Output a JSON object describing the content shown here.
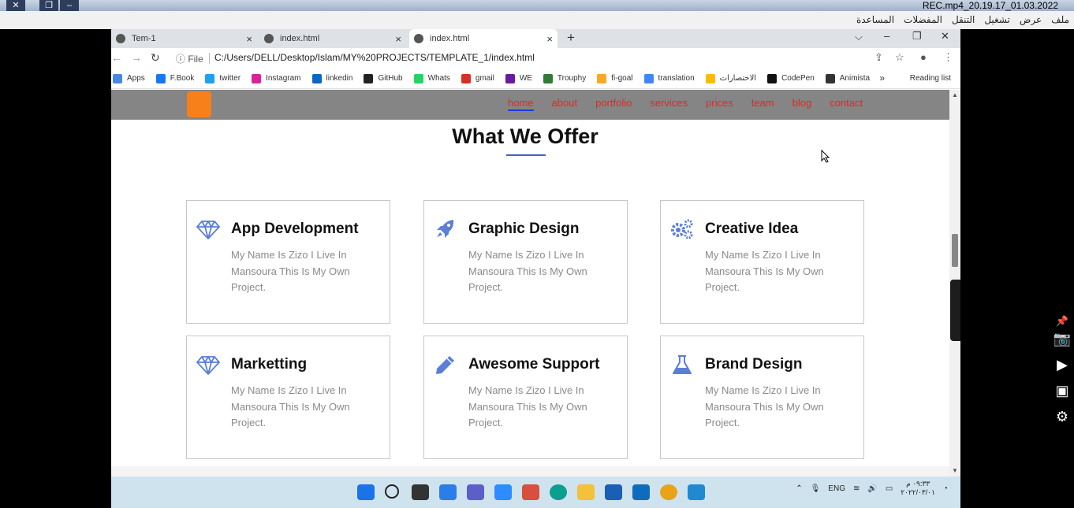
{
  "player": {
    "title": "REC.mp4_20.19.17_01.03.2022",
    "menu": [
      "ملف",
      "عرض",
      "تشغيل",
      "التنقل",
      "المفضلات",
      "المساعدة"
    ]
  },
  "browser": {
    "tabs": [
      {
        "label": "Tem-1",
        "close": "×"
      },
      {
        "label": "index.html",
        "close": "×"
      },
      {
        "label": "index.html",
        "close": "×"
      }
    ],
    "new_tab": "+",
    "window_controls": {
      "dropdown": "⌵",
      "minimize": "–",
      "restore": "❐",
      "close": "✕"
    },
    "address": {
      "scheme_label": "File",
      "url": "C:/Users/DELL/Desktop/Islam/MY%20PROJECTS/TEMPLATE_1/index.html"
    },
    "bookmarks": [
      {
        "label": "Apps",
        "color": "#4a86e8"
      },
      {
        "label": "F.Book",
        "color": "#1877f2"
      },
      {
        "label": "twitter",
        "color": "#1da1f2"
      },
      {
        "label": "Instagram",
        "color": "#d6249f"
      },
      {
        "label": "linkedin",
        "color": "#0a66c2"
      },
      {
        "label": "GitHub",
        "color": "#222222"
      },
      {
        "label": "Whats",
        "color": "#25d366"
      },
      {
        "label": "gmail",
        "color": "#d93025"
      },
      {
        "label": "WE",
        "color": "#6a1b9a"
      },
      {
        "label": "Trouphy",
        "color": "#2e7d32"
      },
      {
        "label": "fi-goal",
        "color": "#f9a825"
      },
      {
        "label": "translation",
        "color": "#4285f4"
      },
      {
        "label": "الاختصارات",
        "color": "#fbbc05"
      },
      {
        "label": "CodePen",
        "color": "#111111"
      },
      {
        "label": "Animista",
        "color": "#333333"
      }
    ],
    "bookmarks_more": "»",
    "reading_list": "Reading list"
  },
  "site": {
    "nav": [
      "home",
      "about",
      "portfolio",
      "services",
      "prices",
      "team",
      "blog",
      "contact"
    ],
    "nav_active": "home",
    "section_title": "What We Offer",
    "cards": [
      {
        "title": "App Development",
        "icon": "diamond-icon",
        "text": "My Name Is Zizo I Live In Mansoura This Is My Own Project."
      },
      {
        "title": "Graphic Design",
        "icon": "rocket-icon",
        "text": "My Name Is Zizo I Live In Mansoura This Is My Own Project."
      },
      {
        "title": "Creative Idea",
        "icon": "gears-icon",
        "text": "My Name Is Zizo I Live In Mansoura This Is My Own Project."
      },
      {
        "title": "Marketting",
        "icon": "diamond-icon",
        "text": "My Name Is Zizo I Live In Mansoura This Is My Own Project."
      },
      {
        "title": "Awesome Support",
        "icon": "pencil-icon",
        "text": "My Name Is Zizo I Live In Mansoura This Is My Own Project."
      },
      {
        "title": "Brand Design",
        "icon": "flask-icon",
        "text": "My Name Is Zizo I Live In Mansoura This Is My Own Project."
      }
    ],
    "icon_color": "#5b7fd6"
  },
  "taskbar": {
    "lang": "ENG",
    "time": "٠٩:٣٣ م",
    "date": "٢٠٢٢/٠٣/٠١"
  }
}
